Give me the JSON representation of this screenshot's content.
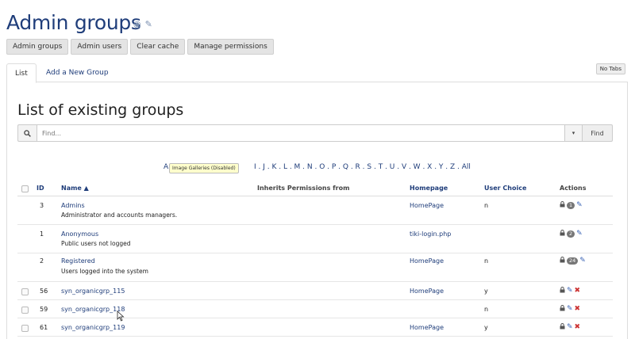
{
  "page": {
    "title": "Admin groups"
  },
  "toolbar": {
    "buttons": [
      "Admin groups",
      "Admin users",
      "Clear cache",
      "Manage permissions"
    ]
  },
  "tabs": {
    "list": "List",
    "add": "Add a New Group",
    "no_tabs": "No Tabs"
  },
  "list": {
    "title": "List of existing groups",
    "search_placeholder": "Find...",
    "find_label": "Find",
    "dropdown_glyph": "▾"
  },
  "alpha": {
    "first": "A",
    "rest": "I . J . K . L . M . N . O . P . Q . R . S . T . U . V . W . X . Y . Z . All",
    "tooltip": "Image Galleries (Disabled)"
  },
  "table": {
    "headers": {
      "id": "ID",
      "name": "Name ▲",
      "inherits": "Inherits Permissions from",
      "homepage": "Homepage",
      "user_choice": "User Choice",
      "actions": "Actions"
    },
    "rows": [
      {
        "id": "3",
        "name": "Admins",
        "desc": "Administrator and accounts managers.",
        "homepage": "HomePage",
        "choice": "n",
        "badge": "1",
        "delete": false,
        "checkbox": false
      },
      {
        "id": "1",
        "name": "Anonymous",
        "desc": "Public users not logged",
        "homepage": "tiki-login.php",
        "choice": "",
        "badge": "2",
        "delete": false,
        "checkbox": false
      },
      {
        "id": "2",
        "name": "Registered",
        "desc": "Users logged into the system",
        "homepage": "HomePage",
        "choice": "n",
        "badge": "24",
        "delete": false,
        "checkbox": false
      },
      {
        "id": "56",
        "name": "syn_organicgrp_115",
        "desc": "",
        "homepage": "HomePage",
        "choice": "y",
        "badge": "",
        "delete": true,
        "checkbox": true
      },
      {
        "id": "59",
        "name": "syn_organicgrp_118",
        "desc": "",
        "homepage": "",
        "choice": "n",
        "badge": "",
        "delete": true,
        "checkbox": true
      },
      {
        "id": "61",
        "name": "syn_organicgrp_119",
        "desc": "",
        "homepage": "HomePage",
        "choice": "y",
        "badge": "",
        "delete": true,
        "checkbox": true
      }
    ]
  },
  "icons": {
    "lock": "🔒",
    "edit": "✎",
    "delete": "✖",
    "search": "search-icon"
  }
}
